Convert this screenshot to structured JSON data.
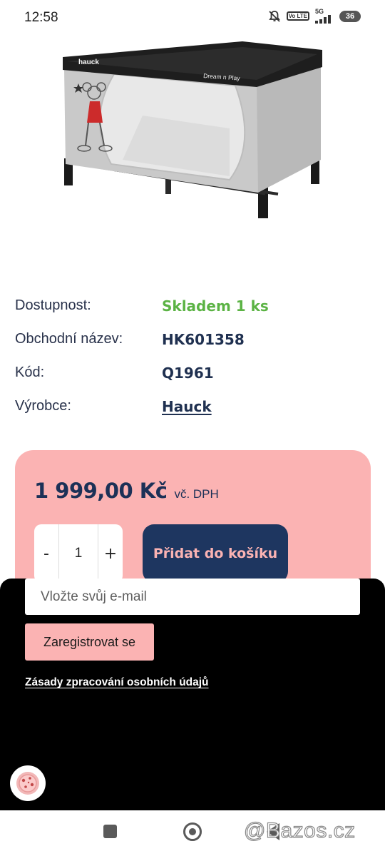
{
  "status_bar": {
    "time": "12:58",
    "icons": [
      "bell-off-icon",
      "volte-icon",
      "5g-signal-icon",
      "battery-icon"
    ],
    "volte_text": "Vo LTE",
    "network": "5G",
    "battery": "36"
  },
  "product": {
    "image_icon": "travel-cot-image",
    "brand_on_image": "hauck",
    "model_on_image": "Dream n Play"
  },
  "info": [
    {
      "label": "Dostupnost:",
      "value": "Skladem 1 ks"
    },
    {
      "label": "Obchodní název:",
      "value": "HK601358"
    },
    {
      "label": "Kód:",
      "value": "Q1961"
    },
    {
      "label": "Výrobce:",
      "value": "Hauck"
    }
  ],
  "price_card": {
    "price": "1 999,00 Kč",
    "vat": "vč. DPH",
    "qty_minus": "-",
    "qty_value": "1",
    "qty_plus": "+",
    "add_to_cart": "Přidat do košíku"
  },
  "newsletter": {
    "email_placeholder": "Vložte svůj e-mail",
    "register": "Zaregistrovat se",
    "privacy_link": "Zásady zpracování osobních údajů",
    "cookie_icon": "cookie-icon"
  },
  "nav_bar": {
    "watermark": "@Bazos.cz"
  },
  "colors": {
    "available_green": "#5bb344",
    "navy": "#1e3660",
    "pink": "#fbb3b3",
    "overlay_black": "#000000"
  }
}
